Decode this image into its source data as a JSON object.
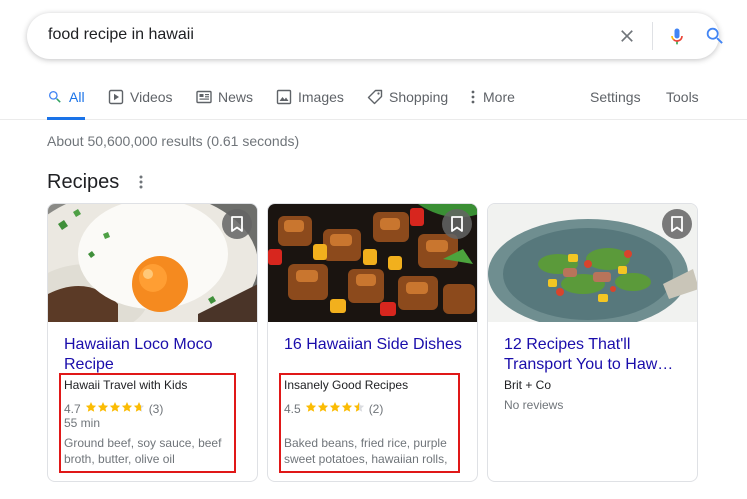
{
  "search": {
    "query": "food recipe in hawaii"
  },
  "tabs": [
    {
      "label": "All",
      "icon": "search-icon",
      "active": true
    },
    {
      "label": "Videos",
      "icon": "play-icon"
    },
    {
      "label": "News",
      "icon": "newspaper-icon"
    },
    {
      "label": "Images",
      "icon": "image-icon"
    },
    {
      "label": "Shopping",
      "icon": "tag-icon"
    },
    {
      "label": "More",
      "icon": "more-vert-icon"
    }
  ],
  "tools": {
    "settings": "Settings",
    "tools": "Tools"
  },
  "result_stats": "About 50,600,000 results (0.61 seconds)",
  "recipes": {
    "title": "Recipes",
    "cards": [
      {
        "title": "Hawaiian Loco Moco Recipe",
        "source": "Hawaii Travel with Kids",
        "rating": "4.7",
        "stars": 4.7,
        "count": "(3)",
        "time": "55 min",
        "ingredients": "Ground beef, soy sauce, beef broth, butter, olive oil"
      },
      {
        "title": "16 Hawaiian Side Dishes",
        "source": "Insanely Good Recipes",
        "rating": "4.5",
        "stars": 4.5,
        "count": "(2)",
        "ingredients": "Baked beans, fried rice, purple sweet potatoes, hawaiian rolls,"
      },
      {
        "title": "12 Recipes That'll Transport You to Haw…",
        "source": "Brit + Co",
        "reviews": "No reviews"
      }
    ]
  },
  "colors": {
    "link": "#1a0dab",
    "accent": "#1a73e8",
    "star": "#fbbc04",
    "highlight": "#e01818"
  }
}
